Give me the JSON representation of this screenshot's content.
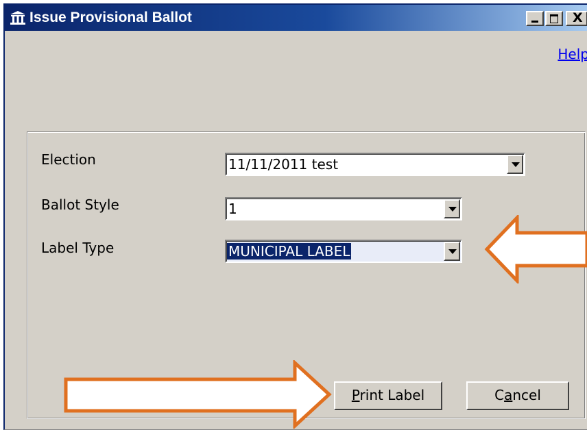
{
  "window": {
    "title": "Issue Provisional Ballot",
    "close_glyph": "X"
  },
  "help_link": "Help",
  "form": {
    "election": {
      "label": "Election",
      "value": "11/11/2011 test"
    },
    "ballot_style": {
      "label": "Ballot Style",
      "value": "1"
    },
    "label_type": {
      "label": "Label Type",
      "value": "MUNICIPAL LABEL"
    }
  },
  "buttons": {
    "print_label": {
      "before": "",
      "mnemonic": "P",
      "after": "rint Label"
    },
    "cancel": {
      "before": "C",
      "mnemonic": "a",
      "after": "ncel"
    }
  },
  "annotations": {
    "arrow_color": "#e07020",
    "arrow_fill": "#ffffff"
  },
  "icons": [
    "courthouse-icon",
    "minimize-icon",
    "maximize-icon",
    "close-icon",
    "dropdown-arrow-icon",
    "arrow-left-annotation",
    "arrow-right-annotation"
  ]
}
